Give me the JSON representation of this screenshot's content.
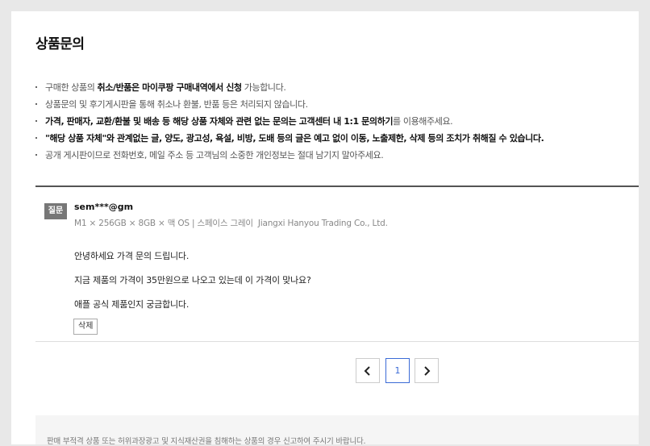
{
  "section": {
    "title": "상품문의"
  },
  "notices": {
    "n1_pre": "구매한 상품의 ",
    "n1_bold": "취소/반품은 마이쿠팡 구매내역에서 신청",
    "n1_post": " 가능합니다.",
    "n2": "상품문의 및 후기게시판을 통해 취소나 환불, 반품 등은 처리되지 않습니다.",
    "n3_bold": "가격, 판매자, 교환/환불 및 배송 등 해당 상품 자체와 관련 없는 문의는 고객센터 내 1:1 문의하기",
    "n3_post": "를 이용해주세요.",
    "n4": "\"해당 상품 자체\"와 관계없는 글, 양도, 광고성, 욕설, 비방, 도배 등의 글은 예고 없이 이동, 노출제한, 삭제 등의 조치가 취해질 수 있습니다.",
    "n5": "공개 게시판이므로 전화번호, 메일 주소 등 고객님의 소중한 개인정보는 절대 남기지 말아주세요."
  },
  "inquiry": {
    "badge": "질문",
    "author": "sem***@gm",
    "option": "M1 × 256GB × 8GB × 맥 OS | 스페이스 그레이",
    "seller": "Jiangxi Hanyou Trading Co., Ltd.",
    "lines": [
      "안녕하세요 가격 문의 드립니다.",
      "지금 제품의 가격이 35만원으로 나오고 있는데 이 가격이 맞나요?",
      "애플 공식 제품인지 궁금합니다."
    ],
    "delete_label": "삭제"
  },
  "pagination": {
    "current_page": "1",
    "prev_icon": "chevron-left-icon",
    "next_icon": "chevron-right-icon"
  },
  "footer": {
    "report_text": "판매 부적격 상품 또는 허위과장광고 및 지식재산권을 침해하는 상품의 경우 신고하여 주시기 바랍니다."
  },
  "colors": {
    "accent": "#3b6bd6",
    "badge_bg": "#777777"
  }
}
